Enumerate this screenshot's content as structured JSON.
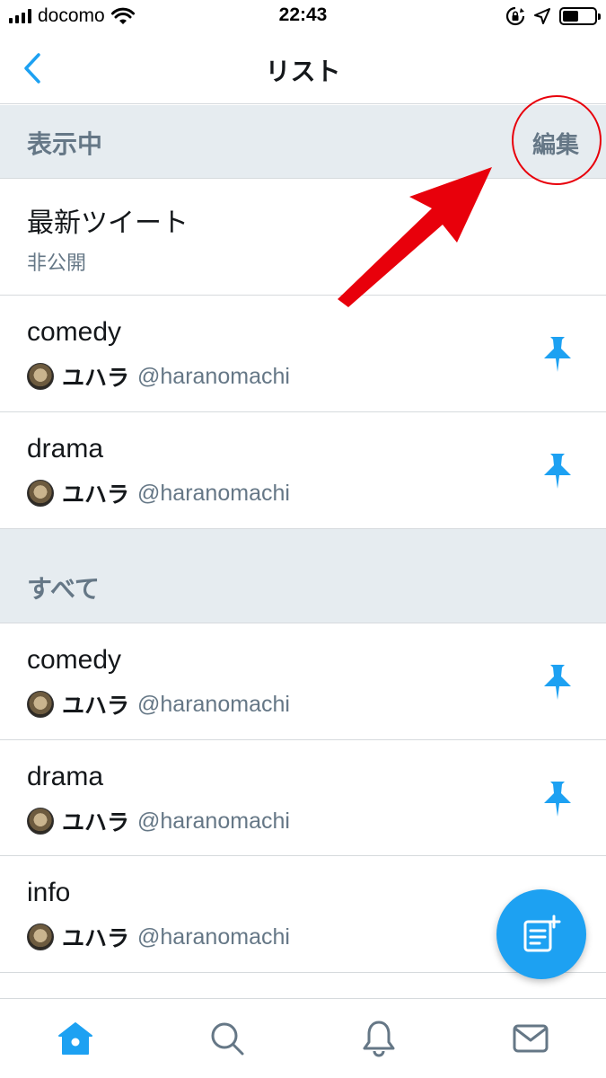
{
  "status_bar": {
    "carrier": "docomo",
    "time": "22:43"
  },
  "nav": {
    "title": "リスト",
    "back_icon": "chevron-left-icon"
  },
  "sections": {
    "showing": {
      "title": "表示中",
      "edit_label": "編集"
    },
    "all": {
      "title": "すべて"
    }
  },
  "showing_lists": [
    {
      "name": "最新ツイート",
      "subtitle": "非公開"
    },
    {
      "name": "comedy",
      "owner_name": "ユハラ",
      "owner_handle": "@haranomachi",
      "pinned": true
    },
    {
      "name": "drama",
      "owner_name": "ユハラ",
      "owner_handle": "@haranomachi",
      "pinned": true
    }
  ],
  "all_lists": [
    {
      "name": "comedy",
      "owner_name": "ユハラ",
      "owner_handle": "@haranomachi",
      "pinned": true
    },
    {
      "name": "drama",
      "owner_name": "ユハラ",
      "owner_handle": "@haranomachi",
      "pinned": true
    },
    {
      "name": "info",
      "owner_name": "ユハラ",
      "owner_handle": "@haranomachi",
      "pinned": true
    }
  ],
  "fab": {
    "icon": "compose-list-icon"
  },
  "tabs": [
    {
      "icon": "home-icon",
      "active": true
    },
    {
      "icon": "search-icon",
      "active": false
    },
    {
      "icon": "bell-icon",
      "active": false
    },
    {
      "icon": "mail-icon",
      "active": false
    }
  ],
  "colors": {
    "accent": "#1da1f2",
    "section_bg": "#e6ecf0",
    "secondary_text": "#657786",
    "annotation_red": "#e8000b"
  }
}
